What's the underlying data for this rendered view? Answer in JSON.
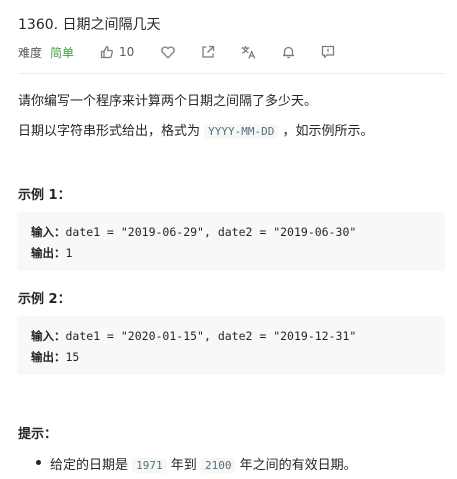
{
  "problem": {
    "title": "1360. 日期之间隔几天",
    "difficulty_label": "难度",
    "difficulty": "简单",
    "like_count": "10",
    "icons": [
      "thumbs-up-icon",
      "heart-icon",
      "share-icon",
      "translate-icon",
      "bell-icon",
      "comment-icon"
    ]
  },
  "description": {
    "line1": "请你编写一个程序来计算两个日期之间隔了多少天。",
    "line2_prefix": "日期以字符串形式给出，格式为",
    "line2_code": "YYYY-MM-DD",
    "line2_suffix": "，如示例所示。"
  },
  "examples": [
    {
      "heading": "示例 1：",
      "input_label": "输入：",
      "input_value": "date1 = \"2019-06-29\", date2 = \"2019-06-30\"",
      "output_label": "输出：",
      "output_value": "1"
    },
    {
      "heading": "示例 2：",
      "input_label": "输入：",
      "input_value": "date1 = \"2020-01-15\", date2 = \"2019-12-31\"",
      "output_label": "输出：",
      "output_value": "15"
    }
  ],
  "hints": {
    "heading": "提示：",
    "item_prefix": "给定的日期是",
    "item_code1": "1971",
    "item_mid": "年到",
    "item_code2": "2100",
    "item_suffix": "年之间的有效日期。"
  },
  "colors": {
    "difficulty_easy": "#43a047",
    "code_bg": "#f7f8fa",
    "inline_code": "#546e7a"
  }
}
